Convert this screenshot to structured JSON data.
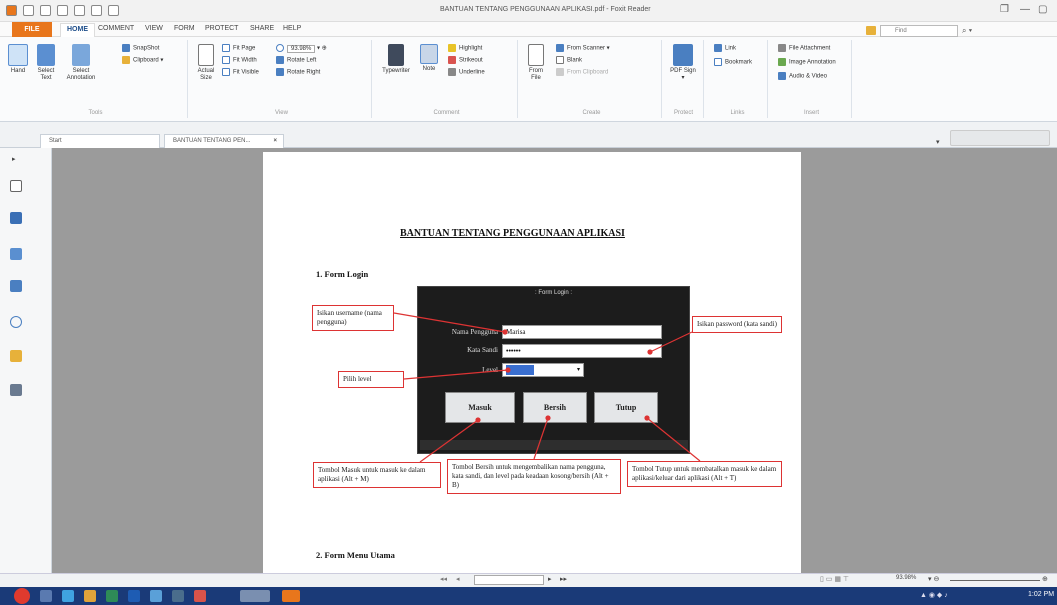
{
  "window": {
    "title": "BANTUAN TENTANG PENGGUNAAN APLIKASI.pdf - Foxit Reader"
  },
  "menu": {
    "file": "FILE",
    "tabs": [
      "HOME",
      "COMMENT",
      "VIEW",
      "FORM",
      "PROTECT",
      "SHARE",
      "HELP"
    ],
    "search_placeholder": "Find"
  },
  "ribbon": {
    "tools": {
      "hand": "Hand",
      "select_text": "Select Text",
      "select_annotation": "Select Annotation",
      "snapshot": "SnapShot",
      "clipboard": "Clipboard",
      "label": "Tools"
    },
    "view": {
      "actual_size": "Actual Size",
      "fit_page": "Fit Page",
      "fit_width": "Fit Width",
      "fit_visible": "Fit Visible",
      "zoom": "93.98%",
      "rotate_left": "Rotate Left",
      "rotate_right": "Rotate Right",
      "label": "View"
    },
    "comment": {
      "typewriter": "Typewriter",
      "note": "Note",
      "highlight": "Highlight",
      "strikeout": "Strikeout",
      "underline": "Underline",
      "label": "Comment"
    },
    "create": {
      "from_file": "From File",
      "from_scanner": "From Scanner",
      "blank": "Blank",
      "from_clipboard": "From Clipboard",
      "label": "Create"
    },
    "protect": {
      "pdf_sign": "PDF Sign",
      "label": "Protect"
    },
    "links": {
      "link": "Link",
      "bookmark": "Bookmark",
      "label": "Links"
    },
    "insert": {
      "file_attachment": "File Attachment",
      "image_annotation": "Image Annotation",
      "audio_video": "Audio & Video",
      "label": "Insert"
    }
  },
  "tabs": {
    "start": "Start",
    "doc": "BANTUAN TENTANG PEN..."
  },
  "document": {
    "title": "BANTUAN TENTANG PENGGUNAAN APLIKASI",
    "section1": "1.   Form Login",
    "section2": "2.   Form Menu Utama",
    "login": {
      "title": ": Form Login :",
      "user_label": "Nama Pengguna",
      "user_value": "Marisa",
      "pass_label": "Kata Sandi",
      "pass_value": "••••••",
      "level_label": "Level",
      "masuk": "Masuk",
      "bersih": "Bersih",
      "tutup": "Tutup"
    },
    "callouts": {
      "username": "Isikan username (nama pengguna)",
      "password": "Isikan password (kata sandi)",
      "level": "Pilih level",
      "masuk": "Tombol Masuk untuk masuk ke dalam aplikasi (Alt + M)",
      "bersih": "Tombol Bersih untuk mengembalikan nama pengguna, kata sandi, dan level pada keadaan kosong/bersih (Alt + B)",
      "tutup": "Tombol Tutup untuk membatalkan masuk ke dalam aplikasi/keluar dari aplikasi (Alt + T)"
    }
  },
  "status": {
    "zoom": "93.98%"
  },
  "taskbar": {
    "time": "1:02 PM"
  }
}
